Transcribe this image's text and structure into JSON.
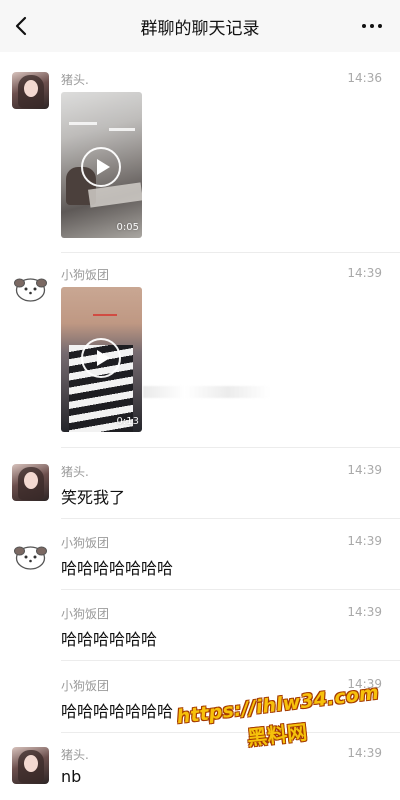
{
  "header": {
    "title": "群聊的聊天记录",
    "back_icon": "chevron-left-icon",
    "more_icon": "more-horizontal-icon"
  },
  "messages": [
    {
      "sender": "猪头.",
      "time": "14:36",
      "type": "video",
      "duration": "0:05",
      "avatar": "photo-avatar"
    },
    {
      "sender": "小狗饭团",
      "time": "14:39",
      "type": "video",
      "duration": "0:13",
      "avatar": "dog-avatar"
    },
    {
      "sender": "猪头.",
      "time": "14:39",
      "type": "text",
      "text": "笑死我了",
      "avatar": "photo-avatar"
    },
    {
      "sender": "小狗饭团",
      "time": "14:39",
      "type": "text",
      "text": "哈哈哈哈哈哈哈",
      "avatar": "dog-avatar"
    },
    {
      "sender": "小狗饭团",
      "time": "14:39",
      "type": "text",
      "text": "哈哈哈哈哈哈"
    },
    {
      "sender": "小狗饭团",
      "time": "14:39",
      "type": "text",
      "text": "哈哈哈哈哈哈哈"
    },
    {
      "sender": "猪头.",
      "time": "14:39",
      "type": "text",
      "text": "nb",
      "avatar": "photo-avatar"
    }
  ],
  "watermark": {
    "url": "https://ihlw34.com",
    "label": "黑料网"
  },
  "colors": {
    "header_bg": "#f7f7f7",
    "meta_text": "#9a9a9a",
    "main_text": "#111111",
    "watermark": "#f5c20b"
  }
}
